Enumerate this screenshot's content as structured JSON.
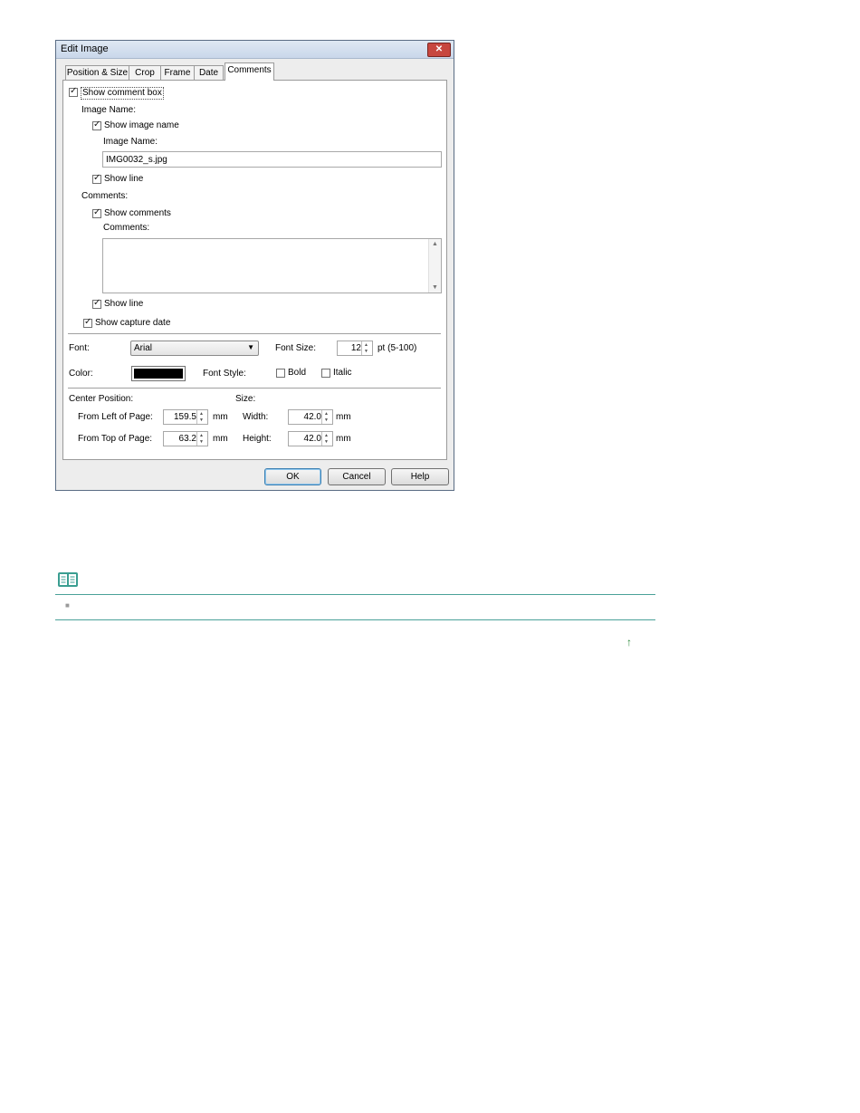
{
  "dialog": {
    "title": "Edit Image",
    "close_symbol": "✕",
    "tabs": [
      {
        "label": "Position & Size",
        "active": false
      },
      {
        "label": "Crop",
        "active": false
      },
      {
        "label": "Frame",
        "active": false
      },
      {
        "label": "Date",
        "active": false
      },
      {
        "label": "Comments",
        "active": true
      }
    ],
    "show_comment_box": {
      "label": "Show comment box",
      "checked": true
    },
    "image_name_section": {
      "heading": "Image Name:",
      "show_image_name": {
        "label": "Show image name",
        "checked": true
      },
      "field_label": "Image Name:",
      "field_value": "IMG0032_s.jpg",
      "show_line": {
        "label": "Show line",
        "checked": true
      }
    },
    "comments_section": {
      "heading": "Comments:",
      "show_comments": {
        "label": "Show comments",
        "checked": true
      },
      "field_label": "Comments:",
      "field_value": "",
      "show_line": {
        "label": "Show line",
        "checked": true
      }
    },
    "show_capture_date": {
      "label": "Show capture date",
      "checked": true
    },
    "font": {
      "label": "Font:",
      "value": "Arial"
    },
    "font_size": {
      "label": "Font Size:",
      "value": "12",
      "unit": "pt (5-100)"
    },
    "color": {
      "label": "Color:",
      "value": "#000000"
    },
    "font_style": {
      "label": "Font Style:",
      "bold": {
        "label": "Bold",
        "checked": false
      },
      "italic": {
        "label": "Italic",
        "checked": false
      }
    },
    "center_position": {
      "heading": "Center Position:",
      "from_left": {
        "label": "From Left of Page:",
        "value": "159.5",
        "unit": "mm"
      },
      "from_top": {
        "label": "From Top of Page:",
        "value": "63.2",
        "unit": "mm"
      }
    },
    "size": {
      "heading": "Size:",
      "width": {
        "label": "Width:",
        "value": "42.0",
        "unit": "mm"
      },
      "height": {
        "label": "Height:",
        "value": "42.0",
        "unit": "mm"
      }
    },
    "buttons": {
      "ok": "OK",
      "cancel": "Cancel",
      "help": "Help"
    }
  },
  "note": {
    "icon": "note-book-icon",
    "bullet": "■"
  },
  "page_top_link": {
    "icon": "arrow-up-icon",
    "symbol": "↑"
  },
  "colors": {
    "note_rule": "#4aa199",
    "note_icon": "#3a9e91",
    "default_button": "#3c7fb1"
  }
}
